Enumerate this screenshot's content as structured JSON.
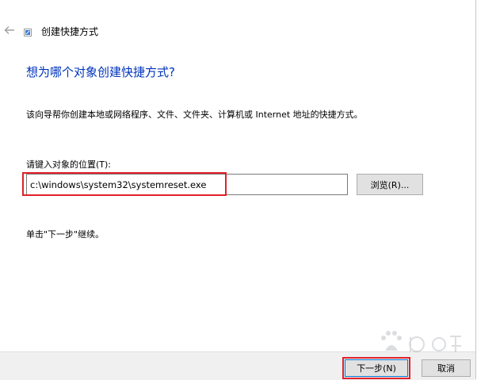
{
  "window": {
    "title": "创建快捷方式"
  },
  "content": {
    "heading": "想为哪个对象创建快捷方式?",
    "description": "该向导帮你创建本地或网络程序、文件、文件夹、计算机或 Internet 地址的快捷方式。",
    "location_label": "请键入对象的位置(T):",
    "location_value": "c:\\windows\\system32\\systemreset.exe",
    "browse_label": "浏览(R)...",
    "hint": "单击\"下一步\"继续。"
  },
  "footer": {
    "next_label": "下一步(N)",
    "cancel_label": "取消"
  },
  "colors": {
    "heading": "#0033bc",
    "highlight": "#e0202a",
    "footer_bg": "#f0f0f0"
  },
  "icons": {
    "back": "back-arrow-icon",
    "shortcut": "shortcut-icon",
    "watermark": "baidu-logo"
  }
}
